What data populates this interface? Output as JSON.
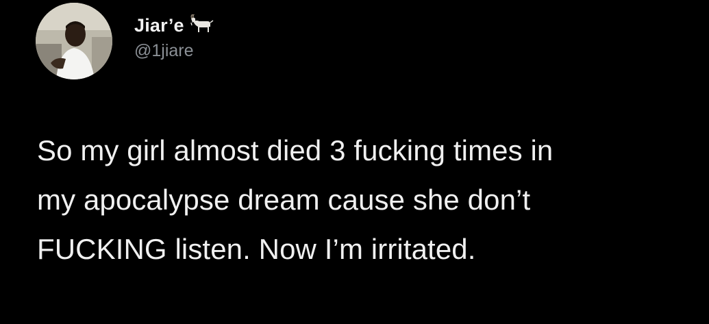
{
  "author": {
    "display_name": "Jiar’e",
    "handle": "@1jiare",
    "badge_icon": "goat-icon"
  },
  "tweet": {
    "lines": [
      "So my girl almost died 3 fucking times in",
      "my apocalypse dream cause she don’t",
      "FUCKING listen. Now I’m irritated."
    ]
  },
  "colors": {
    "background": "#000000",
    "text": "#f0f0f0",
    "handle": "#8b9096"
  }
}
